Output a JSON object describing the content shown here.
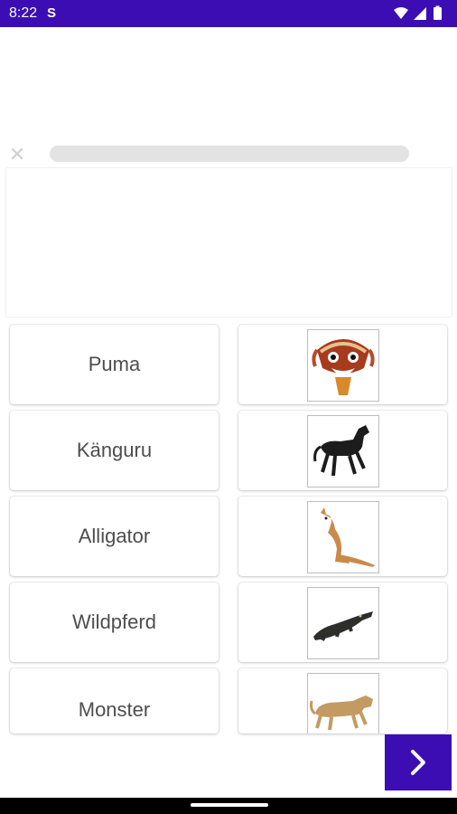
{
  "status_bar": {
    "time": "8:22",
    "notification_glyph": "S"
  },
  "colors": {
    "accent": "#3b0db3"
  },
  "words": [
    "Puma",
    "Känguru",
    "Alligator",
    "Wildpferd",
    "Monster"
  ],
  "images": [
    "demon-mask-icon",
    "black-horse-icon",
    "kangaroo-icon",
    "alligator-icon",
    "puma-icon"
  ],
  "next_button": {
    "icon": "chevron-right-icon"
  }
}
